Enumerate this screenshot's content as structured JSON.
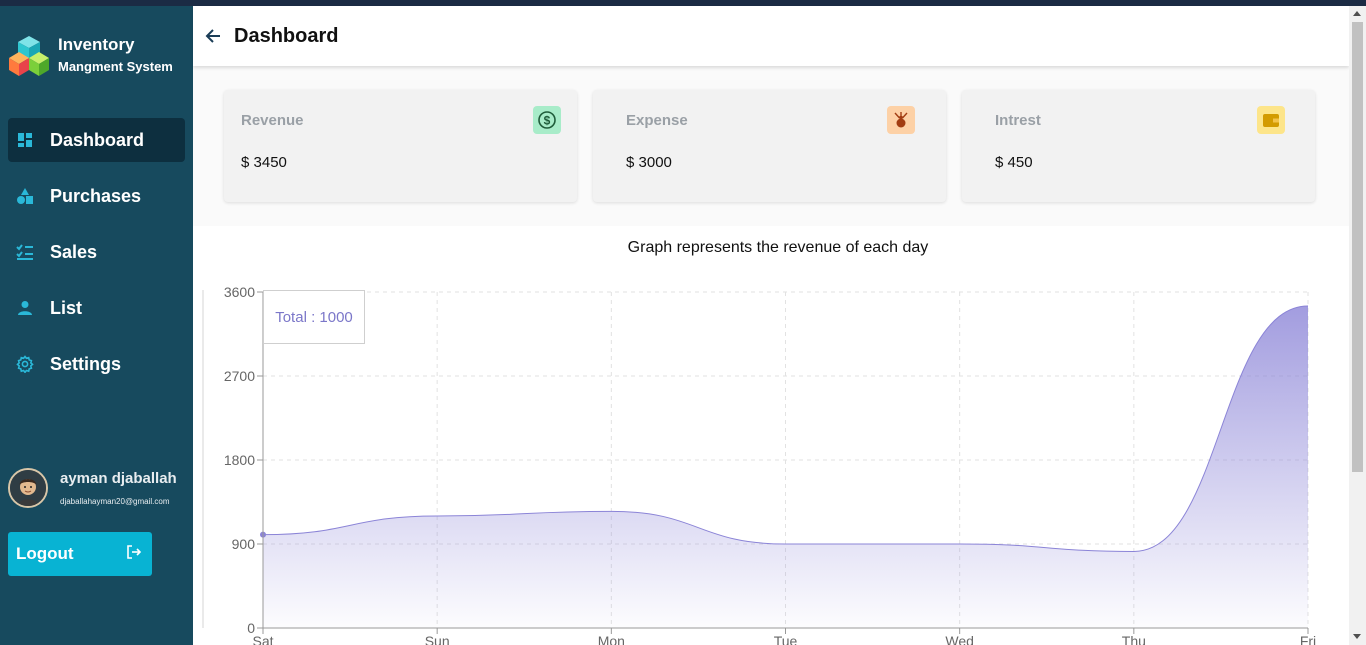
{
  "brand": {
    "title": "Inventory",
    "subtitle": "Mangment System"
  },
  "nav": [
    {
      "label": "Dashboard",
      "icon": "dashboard-icon",
      "active": true
    },
    {
      "label": "Purchases",
      "icon": "shapes-icon",
      "active": false
    },
    {
      "label": "Sales",
      "icon": "checklist-icon",
      "active": false
    },
    {
      "label": "List",
      "icon": "person-icon",
      "active": false
    },
    {
      "label": "Settings",
      "icon": "gear-icon",
      "active": false
    }
  ],
  "user": {
    "name": "ayman djaballah",
    "email": "djaballahayman20@gmail.com"
  },
  "logout_label": "Logout",
  "header": {
    "title": "Dashboard"
  },
  "cards": [
    {
      "label": "Revenue",
      "value": "$ 3450",
      "icon": "dollar-icon",
      "icon_bg": "#a8ecc9",
      "icon_color": "#1f7a4a"
    },
    {
      "label": "Expense",
      "value": "$ 3000",
      "icon": "money-bag-icon",
      "icon_bg": "#fdd1a6",
      "icon_color": "#a23d12"
    },
    {
      "label": "Intrest",
      "value": "$ 450",
      "icon": "wallet-icon",
      "icon_bg": "#fde58a",
      "icon_color": "#d39b00"
    }
  ],
  "chart_title": "Graph represents the revenue of each day",
  "chart_data": {
    "type": "area",
    "title": "Graph represents the revenue of each day",
    "categories": [
      "Sat",
      "Sun",
      "Mon",
      "Tue",
      "Wed",
      "Thu",
      "Fri"
    ],
    "values": [
      1000,
      1200,
      1250,
      900,
      900,
      820,
      3450
    ],
    "ylim": [
      0,
      3600
    ],
    "yticks": [
      0,
      900,
      1800,
      2700,
      3600
    ],
    "grid": true,
    "tooltip": "Total : 1000",
    "color": "#8b84d7"
  }
}
